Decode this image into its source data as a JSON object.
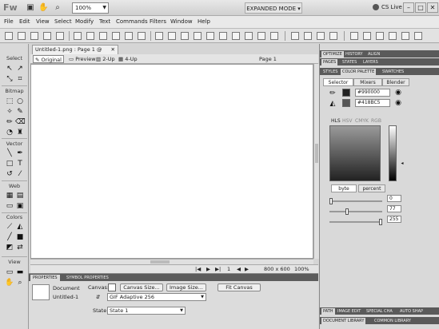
{
  "titlebar": {
    "logo": "Fw",
    "zoom": "100%",
    "mode": "EXPANDED MODE",
    "cslive": "CS Live"
  },
  "menu": [
    "File",
    "Edit",
    "View",
    "Select",
    "Modify",
    "Text",
    "Commands",
    "Filters",
    "Window",
    "Help"
  ],
  "tools": {
    "sections": [
      "Select",
      "Bitmap",
      "Vector",
      "Web",
      "Colors",
      "View"
    ]
  },
  "document": {
    "tab": "Untitled-1.png : Page 1 @ 100%",
    "views": [
      "Original",
      "Preview",
      "2-Up",
      "4-Up"
    ],
    "page": "Page 1",
    "status_page": "1",
    "status_size": "800 x 600",
    "status_zoom": "100%"
  },
  "properties": {
    "tabs": [
      "PROPERTIES",
      "SYMBOL PROPERTIES"
    ],
    "doc_label": "Document",
    "doc_name": "Untitled-1",
    "canvas_label": "Canvas:",
    "canvas_size_btn": "Canvas Size...",
    "image_size_btn": "Image Size...",
    "fit_canvas_btn": "Fit Canvas",
    "format": "GIF Adaptive 256",
    "state_label": "State:",
    "state_value": "State 1"
  },
  "right_panel": {
    "tabs_top": [
      "OPTIMIZE",
      "HISTORY",
      "ALIGN"
    ],
    "tabs_mid": [
      "PAGES",
      "STATES",
      "LAYERS"
    ],
    "tabs_color": [
      "STYLES",
      "COLOR PALETTE",
      "SWATCHES"
    ],
    "subtabs": [
      "Selector",
      "Mixers",
      "Blender"
    ],
    "color1": "#990000",
    "color2": "#418BC5",
    "color_modes": [
      "HLS",
      "HSV",
      "CMYK",
      "RGB"
    ],
    "value_modes": [
      "byte",
      "percent"
    ],
    "values": [
      "0",
      "77",
      "255"
    ],
    "tabs_bottom1": [
      "PATH",
      "IMAGE EDIT",
      "SPECIAL CHA",
      "AUTO SHAP"
    ],
    "tabs_bottom2": [
      "DOCUMENT LIBRARY",
      "COMMON LIBRARY"
    ]
  }
}
